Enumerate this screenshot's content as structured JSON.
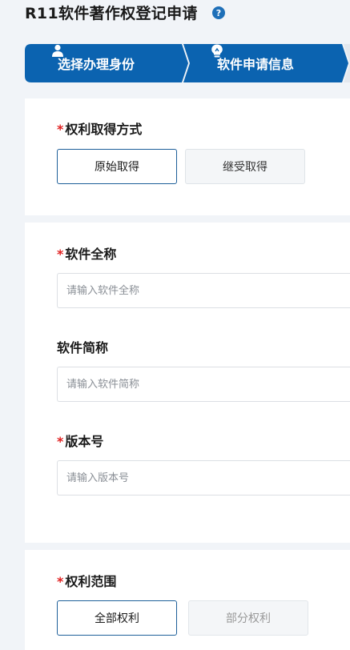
{
  "page": {
    "title": "R11软件著作权登记申请"
  },
  "help": {
    "glyph": "?"
  },
  "steps": [
    {
      "label": "选择办理身份",
      "icon": "user-icon"
    },
    {
      "label": "软件申请信息",
      "icon": "lightbulb-icon"
    }
  ],
  "colors": {
    "step_active": "#0b63b0",
    "required": "#e02020",
    "selected_border": "#1e5f99"
  },
  "required_mark": "*",
  "rights_acquisition": {
    "label": "权利取得方式",
    "options": [
      {
        "label": "原始取得",
        "selected": true
      },
      {
        "label": "继受取得",
        "selected": false
      }
    ]
  },
  "software_full_name": {
    "label": "软件全称",
    "placeholder": "请输入软件全称",
    "value": ""
  },
  "software_short_name": {
    "label": "软件简称",
    "placeholder": "请输入软件简称",
    "value": ""
  },
  "version": {
    "label": "版本号",
    "placeholder": "请输入版本号",
    "value": ""
  },
  "rights_scope": {
    "label": "权利范围",
    "options": [
      {
        "label": "全部权利",
        "selected": true
      },
      {
        "label": "部分权利",
        "selected": false,
        "disabled": true
      }
    ]
  }
}
